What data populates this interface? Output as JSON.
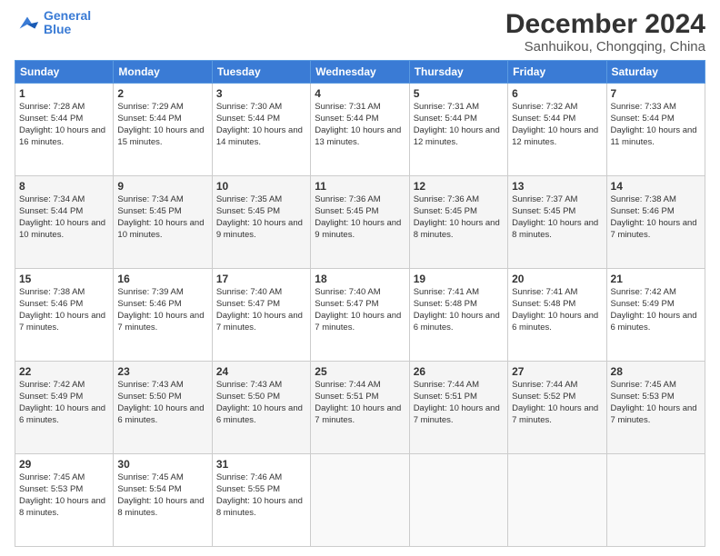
{
  "logo": {
    "line1": "General",
    "line2": "Blue"
  },
  "title": {
    "main": "December 2024",
    "sub": "Sanhuikou, Chongqing, China"
  },
  "days": [
    "Sunday",
    "Monday",
    "Tuesday",
    "Wednesday",
    "Thursday",
    "Friday",
    "Saturday"
  ],
  "weeks": [
    [
      {
        "day": "1",
        "sunrise": "Sunrise: 7:28 AM",
        "sunset": "Sunset: 5:44 PM",
        "daylight": "Daylight: 10 hours and 16 minutes."
      },
      {
        "day": "2",
        "sunrise": "Sunrise: 7:29 AM",
        "sunset": "Sunset: 5:44 PM",
        "daylight": "Daylight: 10 hours and 15 minutes."
      },
      {
        "day": "3",
        "sunrise": "Sunrise: 7:30 AM",
        "sunset": "Sunset: 5:44 PM",
        "daylight": "Daylight: 10 hours and 14 minutes."
      },
      {
        "day": "4",
        "sunrise": "Sunrise: 7:31 AM",
        "sunset": "Sunset: 5:44 PM",
        "daylight": "Daylight: 10 hours and 13 minutes."
      },
      {
        "day": "5",
        "sunrise": "Sunrise: 7:31 AM",
        "sunset": "Sunset: 5:44 PM",
        "daylight": "Daylight: 10 hours and 12 minutes."
      },
      {
        "day": "6",
        "sunrise": "Sunrise: 7:32 AM",
        "sunset": "Sunset: 5:44 PM",
        "daylight": "Daylight: 10 hours and 12 minutes."
      },
      {
        "day": "7",
        "sunrise": "Sunrise: 7:33 AM",
        "sunset": "Sunset: 5:44 PM",
        "daylight": "Daylight: 10 hours and 11 minutes."
      }
    ],
    [
      {
        "day": "8",
        "sunrise": "Sunrise: 7:34 AM",
        "sunset": "Sunset: 5:44 PM",
        "daylight": "Daylight: 10 hours and 10 minutes."
      },
      {
        "day": "9",
        "sunrise": "Sunrise: 7:34 AM",
        "sunset": "Sunset: 5:45 PM",
        "daylight": "Daylight: 10 hours and 10 minutes."
      },
      {
        "day": "10",
        "sunrise": "Sunrise: 7:35 AM",
        "sunset": "Sunset: 5:45 PM",
        "daylight": "Daylight: 10 hours and 9 minutes."
      },
      {
        "day": "11",
        "sunrise": "Sunrise: 7:36 AM",
        "sunset": "Sunset: 5:45 PM",
        "daylight": "Daylight: 10 hours and 9 minutes."
      },
      {
        "day": "12",
        "sunrise": "Sunrise: 7:36 AM",
        "sunset": "Sunset: 5:45 PM",
        "daylight": "Daylight: 10 hours and 8 minutes."
      },
      {
        "day": "13",
        "sunrise": "Sunrise: 7:37 AM",
        "sunset": "Sunset: 5:45 PM",
        "daylight": "Daylight: 10 hours and 8 minutes."
      },
      {
        "day": "14",
        "sunrise": "Sunrise: 7:38 AM",
        "sunset": "Sunset: 5:46 PM",
        "daylight": "Daylight: 10 hours and 7 minutes."
      }
    ],
    [
      {
        "day": "15",
        "sunrise": "Sunrise: 7:38 AM",
        "sunset": "Sunset: 5:46 PM",
        "daylight": "Daylight: 10 hours and 7 minutes."
      },
      {
        "day": "16",
        "sunrise": "Sunrise: 7:39 AM",
        "sunset": "Sunset: 5:46 PM",
        "daylight": "Daylight: 10 hours and 7 minutes."
      },
      {
        "day": "17",
        "sunrise": "Sunrise: 7:40 AM",
        "sunset": "Sunset: 5:47 PM",
        "daylight": "Daylight: 10 hours and 7 minutes."
      },
      {
        "day": "18",
        "sunrise": "Sunrise: 7:40 AM",
        "sunset": "Sunset: 5:47 PM",
        "daylight": "Daylight: 10 hours and 7 minutes."
      },
      {
        "day": "19",
        "sunrise": "Sunrise: 7:41 AM",
        "sunset": "Sunset: 5:48 PM",
        "daylight": "Daylight: 10 hours and 6 minutes."
      },
      {
        "day": "20",
        "sunrise": "Sunrise: 7:41 AM",
        "sunset": "Sunset: 5:48 PM",
        "daylight": "Daylight: 10 hours and 6 minutes."
      },
      {
        "day": "21",
        "sunrise": "Sunrise: 7:42 AM",
        "sunset": "Sunset: 5:49 PM",
        "daylight": "Daylight: 10 hours and 6 minutes."
      }
    ],
    [
      {
        "day": "22",
        "sunrise": "Sunrise: 7:42 AM",
        "sunset": "Sunset: 5:49 PM",
        "daylight": "Daylight: 10 hours and 6 minutes."
      },
      {
        "day": "23",
        "sunrise": "Sunrise: 7:43 AM",
        "sunset": "Sunset: 5:50 PM",
        "daylight": "Daylight: 10 hours and 6 minutes."
      },
      {
        "day": "24",
        "sunrise": "Sunrise: 7:43 AM",
        "sunset": "Sunset: 5:50 PM",
        "daylight": "Daylight: 10 hours and 6 minutes."
      },
      {
        "day": "25",
        "sunrise": "Sunrise: 7:44 AM",
        "sunset": "Sunset: 5:51 PM",
        "daylight": "Daylight: 10 hours and 7 minutes."
      },
      {
        "day": "26",
        "sunrise": "Sunrise: 7:44 AM",
        "sunset": "Sunset: 5:51 PM",
        "daylight": "Daylight: 10 hours and 7 minutes."
      },
      {
        "day": "27",
        "sunrise": "Sunrise: 7:44 AM",
        "sunset": "Sunset: 5:52 PM",
        "daylight": "Daylight: 10 hours and 7 minutes."
      },
      {
        "day": "28",
        "sunrise": "Sunrise: 7:45 AM",
        "sunset": "Sunset: 5:53 PM",
        "daylight": "Daylight: 10 hours and 7 minutes."
      }
    ],
    [
      {
        "day": "29",
        "sunrise": "Sunrise: 7:45 AM",
        "sunset": "Sunset: 5:53 PM",
        "daylight": "Daylight: 10 hours and 8 minutes."
      },
      {
        "day": "30",
        "sunrise": "Sunrise: 7:45 AM",
        "sunset": "Sunset: 5:54 PM",
        "daylight": "Daylight: 10 hours and 8 minutes."
      },
      {
        "day": "31",
        "sunrise": "Sunrise: 7:46 AM",
        "sunset": "Sunset: 5:55 PM",
        "daylight": "Daylight: 10 hours and 8 minutes."
      },
      null,
      null,
      null,
      null
    ]
  ]
}
